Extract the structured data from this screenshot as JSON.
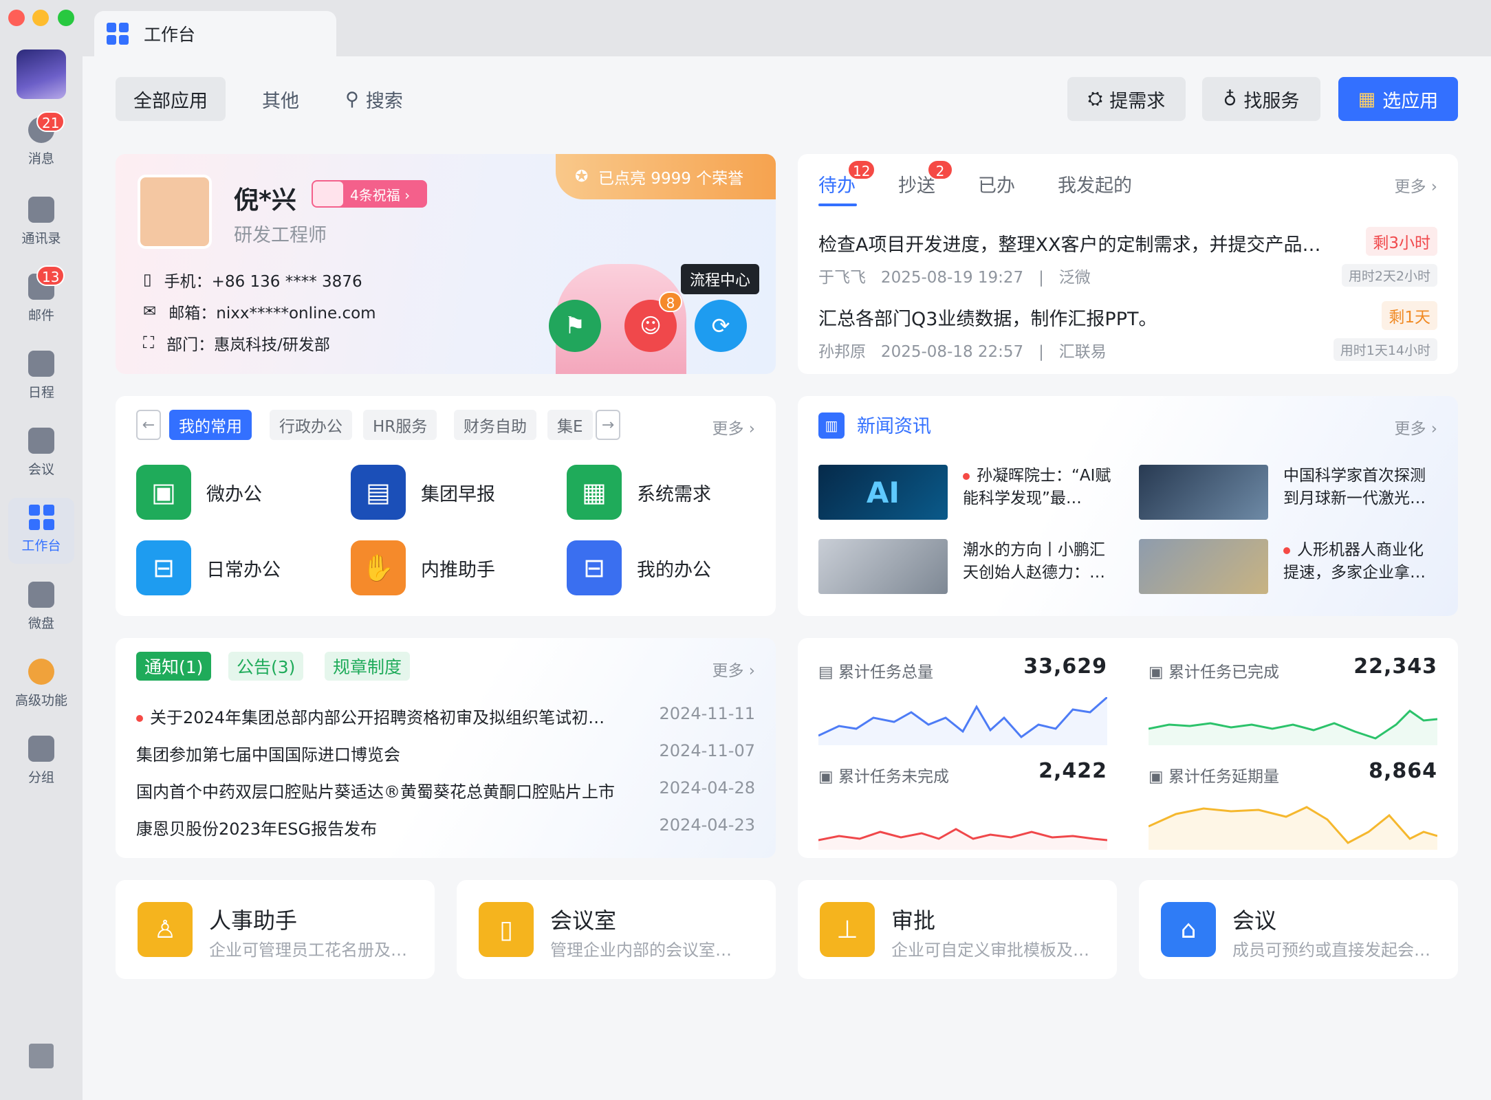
{
  "window": {
    "tab_title": "工作台"
  },
  "nav": [
    {
      "label": "消息",
      "badge": "21"
    },
    {
      "label": "通讯录"
    },
    {
      "label": "邮件",
      "badge": "13"
    },
    {
      "label": "日程"
    },
    {
      "label": "会议"
    },
    {
      "label": "工作台"
    },
    {
      "label": "微盘"
    },
    {
      "label": "高级功能"
    },
    {
      "label": "分组"
    }
  ],
  "toolbar": {
    "tab_all": "全部应用",
    "tab_other": "其他",
    "search": "搜索",
    "btn_demand": "提需求",
    "btn_service": "找服务",
    "btn_select": "选应用"
  },
  "profile": {
    "name": "倪*兴",
    "blessing": "4条祝福 ›",
    "title": "研发工程师",
    "honor": "已点亮 9999 个荣誉",
    "phone": "手机：+86 136 **** 3876",
    "email": "邮箱：nixx*****online.com",
    "dept": "部门：惠岚科技/研发部",
    "flow_tip": "流程中心",
    "badge_approve": "8"
  },
  "tasks": {
    "tab_todo": "待办",
    "todo_badge": "12",
    "tab_cc": "抄送",
    "cc_badge": "2",
    "tab_done": "已办",
    "tab_mine": "我发起的",
    "more": "更多 ›",
    "items": [
      {
        "title": "检查A项目开发进度，整理XX客户的定制需求，并提交产品…",
        "tag": "剩3小时",
        "meta": "于飞飞   2025-08-19 19:27   |   泛微",
        "used": "用时2天2小时"
      },
      {
        "title": "汇总各部门Q3业绩数据，制作汇报PPT。",
        "tag": "剩1天",
        "meta": "孙邦原   2025-08-18 22:57   |   汇联易",
        "used": "用时1天14小时"
      }
    ]
  },
  "apps": {
    "tabs": [
      "我的常用",
      "行政办公",
      "HR服务",
      "财务自助",
      "集E"
    ],
    "more": "更多 ›",
    "items": [
      "微办公",
      "集团早报",
      "系统需求",
      "日常办公",
      "内推助手",
      "我的办公"
    ]
  },
  "news": {
    "title": "新闻资讯",
    "more": "更多 ›",
    "items": [
      "孙凝晖院士：“AI赋能科学发现”最…",
      "中国科学家首次探测到月球新一代激光…",
      "潮水的方向丨小鹏汇天创始人赵德力：…",
      "人形机器人商业化提速，多家企业拿…"
    ],
    "ai_label": "AI"
  },
  "notice": {
    "tab1": "通知(1)",
    "tab2": "公告(3)",
    "tab3": "规章制度",
    "more": "更多 ›",
    "items": [
      {
        "title": "关于2024年集团总部内部公开招聘资格初审及拟组织笔试初…",
        "date": "2024-11-11"
      },
      {
        "title": "集团参加第七届中国国际进口博览会",
        "date": "2024-11-07"
      },
      {
        "title": "国内首个中药双层口腔贴片葵适达®黄蜀葵花总黄酮口腔贴片上市",
        "date": "2024-04-28"
      },
      {
        "title": "康恩贝股份2023年ESG报告发布",
        "date": "2024-04-23"
      }
    ]
  },
  "stats": [
    {
      "label": "累计任务总量",
      "value": "33,629",
      "color": "#4e7cf6"
    },
    {
      "label": "累计任务已完成",
      "value": "22,343",
      "color": "#2cc36b"
    },
    {
      "label": "累计任务未完成",
      "value": "2,422",
      "color": "#f0484b"
    },
    {
      "label": "累计任务延期量",
      "value": "8,864",
      "color": "#f5b82e"
    }
  ],
  "tools": [
    {
      "title": "人事助手",
      "desc": "企业可管理员工花名册及…"
    },
    {
      "title": "会议室",
      "desc": "管理企业内部的会议室…"
    },
    {
      "title": "审批",
      "desc": "企业可自定义审批模板及…"
    },
    {
      "title": "会议",
      "desc": "成员可预约或直接发起会…"
    }
  ]
}
